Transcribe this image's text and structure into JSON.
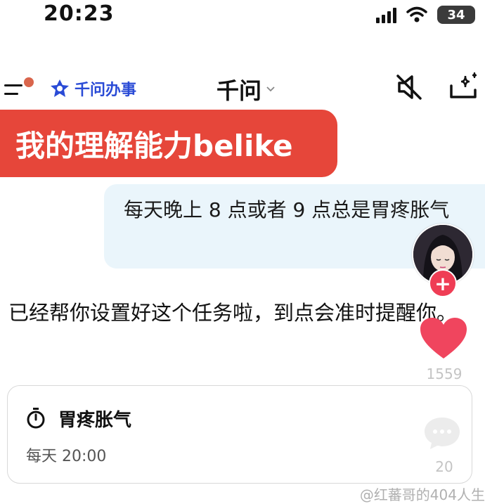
{
  "status_bar": {
    "time": "20:23",
    "battery": "34"
  },
  "header": {
    "brand_label": "千问办事",
    "title": "千问",
    "icons": [
      "menu-icon",
      "brand-logo-icon",
      "chevron-down-icon",
      "mute-speaker-icon",
      "new-chat-sparkle-icon"
    ]
  },
  "caption": "我的理解能力belike",
  "chat": {
    "user_message": "每天晚上 8 点或者 9 点总是胃疼胀气",
    "assistant_reply": "已经帮你设置好这个任务啦，到点会准时提醒你。"
  },
  "reminder_card": {
    "title": "胃疼胀气",
    "schedule": "每天 20:00"
  },
  "side_actions": {
    "like_count": "1559",
    "comment_count": "20",
    "follow_symbol": "+"
  },
  "watermark": "@红蕃哥的404人生",
  "colors": {
    "caption_bg": "#e6463a",
    "brand": "#2a4bd6",
    "user_bubble_bg": "#eaf5fb",
    "like": "#f0455e"
  }
}
